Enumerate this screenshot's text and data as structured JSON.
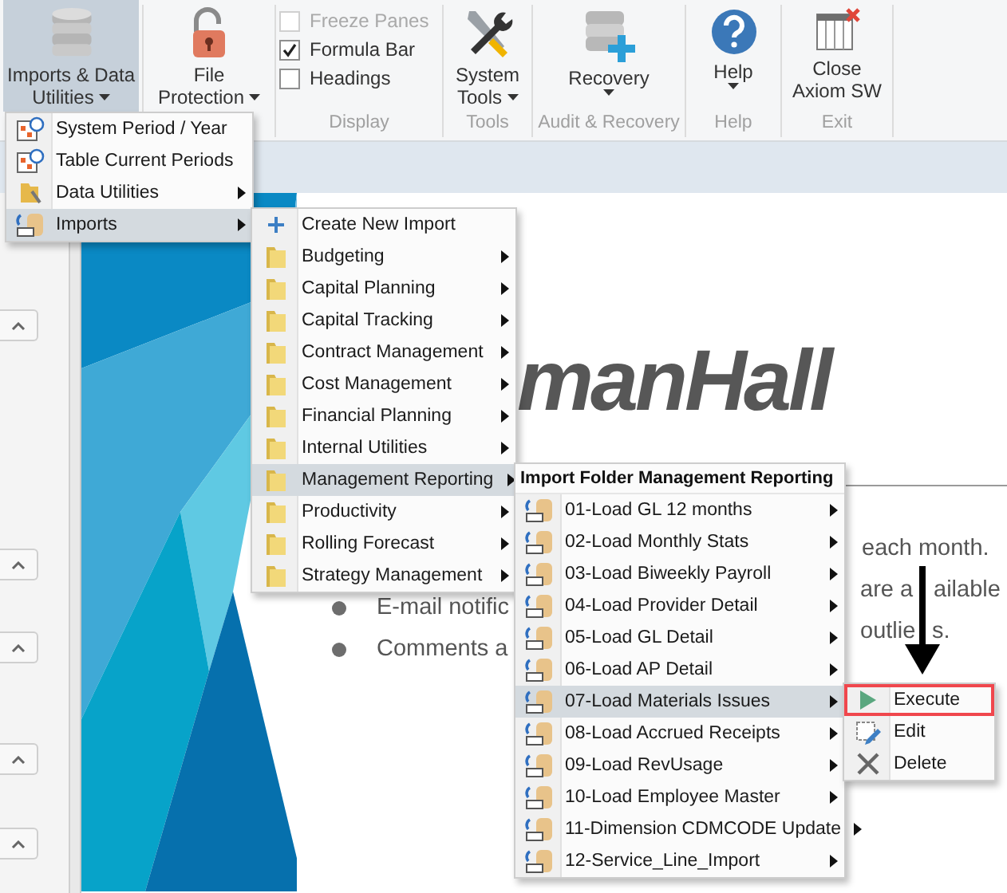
{
  "ribbon": {
    "groups": [
      {
        "controls": [
          {
            "kind": "button",
            "lines": [
              "Imports & Data",
              "Utilities"
            ],
            "dropdown": true,
            "selected": true
          }
        ]
      },
      {
        "controls": [
          {
            "kind": "button",
            "lines": [
              "File",
              "Protection"
            ],
            "dropdown": true,
            "selected": false
          }
        ]
      },
      {
        "label": "Display",
        "controls": [
          {
            "kind": "checkbox",
            "label": "Freeze Panes",
            "checked": false,
            "disabled": true
          },
          {
            "kind": "checkbox",
            "label": "Formula Bar",
            "checked": true,
            "disabled": false
          },
          {
            "kind": "checkbox",
            "label": "Headings",
            "checked": false,
            "disabled": false
          }
        ]
      },
      {
        "label": "Tools",
        "controls": [
          {
            "kind": "button",
            "lines": [
              "System",
              "Tools"
            ],
            "dropdown": true,
            "selected": false
          }
        ]
      },
      {
        "label": "Audit & Recovery",
        "controls": [
          {
            "kind": "button",
            "lines": [
              "Recovery"
            ],
            "dropdown": true,
            "selected": false
          }
        ]
      },
      {
        "label": "Help",
        "controls": [
          {
            "kind": "button",
            "lines": [
              "Help"
            ],
            "dropdown": true,
            "selected": false
          }
        ]
      },
      {
        "label": "Exit",
        "controls": [
          {
            "kind": "button",
            "lines": [
              "Close",
              "Axiom SW"
            ],
            "dropdown": false,
            "selected": false
          }
        ]
      }
    ]
  },
  "slide": {
    "title": "manHall",
    "fragments": [
      "each month.",
      "E-mail notific",
      "are a",
      "ailable",
      "Comments a",
      "outlie",
      "s."
    ]
  },
  "menus": [
    {
      "items": [
        {
          "kind": "periods",
          "label": "System Period / Year",
          "submenu": false,
          "selected": false
        },
        {
          "kind": "periods",
          "label": "Table Current Periods",
          "submenu": false,
          "selected": false
        },
        {
          "kind": "utilities",
          "label": "Data Utilities",
          "submenu": true,
          "selected": false
        },
        {
          "kind": "import",
          "label": "Imports",
          "submenu": true,
          "selected": true
        }
      ]
    },
    {
      "items": [
        {
          "kind": "create",
          "label": "Create New Import",
          "submenu": false,
          "selected": false
        },
        {
          "kind": "folder",
          "label": "Budgeting",
          "submenu": true,
          "selected": false
        },
        {
          "kind": "folder",
          "label": "Capital Planning",
          "submenu": true,
          "selected": false
        },
        {
          "kind": "folder",
          "label": "Capital Tracking",
          "submenu": true,
          "selected": false
        },
        {
          "kind": "folder",
          "label": "Contract Management",
          "submenu": true,
          "selected": false
        },
        {
          "kind": "folder",
          "label": "Cost Management",
          "submenu": true,
          "selected": false
        },
        {
          "kind": "folder",
          "label": "Financial Planning",
          "submenu": true,
          "selected": false
        },
        {
          "kind": "folder",
          "label": "Internal Utilities",
          "submenu": true,
          "selected": false
        },
        {
          "kind": "folder",
          "label": "Management Reporting",
          "submenu": true,
          "selected": true
        },
        {
          "kind": "folder",
          "label": "Productivity",
          "submenu": true,
          "selected": false
        },
        {
          "kind": "folder",
          "label": "Rolling Forecast",
          "submenu": true,
          "selected": false
        },
        {
          "kind": "folder",
          "label": "Strategy Management",
          "submenu": true,
          "selected": false
        }
      ]
    },
    {
      "header": "Import Folder Management Reporting",
      "items": [
        {
          "kind": "import",
          "label": "01-Load GL 12 months",
          "submenu": true,
          "selected": false
        },
        {
          "kind": "import",
          "label": "02-Load Monthly Stats",
          "submenu": true,
          "selected": false
        },
        {
          "kind": "import",
          "label": "03-Load Biweekly Payroll",
          "submenu": true,
          "selected": false
        },
        {
          "kind": "import",
          "label": "04-Load Provider Detail",
          "submenu": true,
          "selected": false
        },
        {
          "kind": "import",
          "label": "05-Load GL Detail",
          "submenu": true,
          "selected": false
        },
        {
          "kind": "import",
          "label": "06-Load AP Detail",
          "submenu": true,
          "selected": false
        },
        {
          "kind": "import",
          "label": "07-Load Materials Issues",
          "submenu": true,
          "selected": true
        },
        {
          "kind": "import",
          "label": "08-Load Accrued Receipts",
          "submenu": true,
          "selected": false
        },
        {
          "kind": "import",
          "label": "09-Load RevUsage",
          "submenu": true,
          "selected": false
        },
        {
          "kind": "import",
          "label": "10-Load Employee Master",
          "submenu": true,
          "selected": false
        },
        {
          "kind": "import",
          "label": "11-Dimension CDMCODE Update",
          "submenu": true,
          "selected": false
        },
        {
          "kind": "import",
          "label": "12-Service_Line_Import",
          "submenu": true,
          "selected": false
        }
      ]
    },
    {
      "items": [
        {
          "kind": "execute",
          "label": "Execute",
          "submenu": false,
          "selected": false,
          "highlighted": true
        },
        {
          "kind": "edit",
          "label": "Edit",
          "submenu": false,
          "selected": false,
          "highlighted": false
        },
        {
          "kind": "delete",
          "label": "Delete",
          "submenu": false,
          "selected": false,
          "highlighted": false
        }
      ]
    }
  ]
}
